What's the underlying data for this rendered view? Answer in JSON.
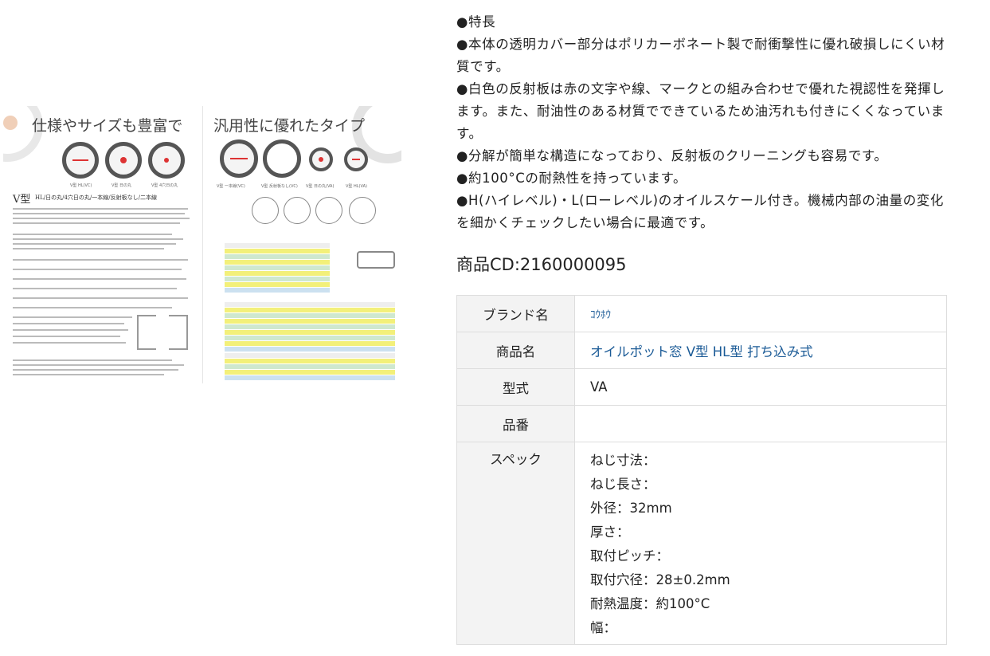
{
  "catalog_image": {
    "heading_left": "仕様やサイズも豊富で",
    "heading_right": "汎用性に優れたタイプ",
    "type_title": "V型",
    "type_subtitle": "HL/日の丸/4穴日の丸/一本線/反射板なし/二本線",
    "captions": [
      "V型 HL(VC)",
      "V型 日の丸",
      "V型 4穴日の丸",
      "V型 一本線(VC)",
      "V型 反射板なし(VC)",
      "V型 日の丸(VA)",
      "V型 HL(VA)"
    ]
  },
  "features": [
    "●特長",
    "●本体の透明カバー部分はポリカーボネート製で耐衝撃性に優れ破損しにくい材質です。",
    "●白色の反射板は赤の文字や線、マークとの組み合わせで優れた視認性を発揮します。また、耐油性のある材質でできているため油汚れも付きにくくなっています。",
    "●分解が簡単な構造になっており、反射板のクリーニングも容易です。",
    "●約100°Cの耐熱性を持っています。",
    "●H(ハイレベル)・L(ローレベル)のオイルスケール付き。機械内部の油量の変化を細かくチェックしたい場合に最適です。"
  ],
  "product_cd": "商品CD:2160000095",
  "spec_table": {
    "brand_label": "ブランド名",
    "brand_value": "ｺｳﾎｳ",
    "name_label": "商品名",
    "name_value": "オイルポット窓 V型 HL型 打ち込み式",
    "model_label": "型式",
    "model_value": "VA",
    "part_label": "品番",
    "part_value": "",
    "spec_label": "スペック",
    "spec_lines": [
      "ねじ寸法：",
      "ねじ長さ：",
      "外径：32mm",
      "厚さ：",
      "取付ピッチ：",
      "取付穴径：28±0.2mm",
      "耐熱温度：約100°C",
      "幅："
    ]
  }
}
